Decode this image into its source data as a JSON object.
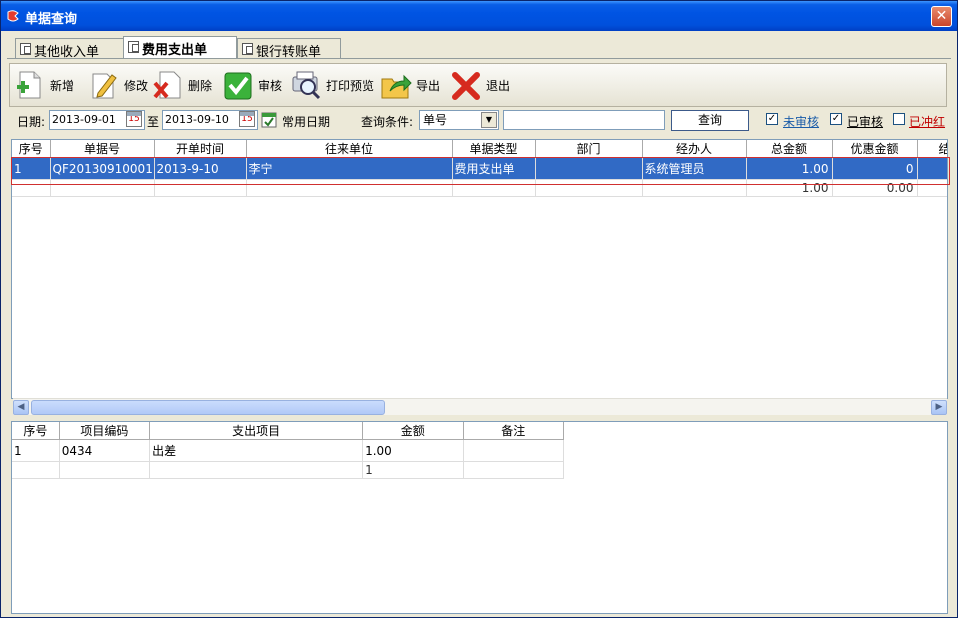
{
  "window": {
    "title": "单据查询",
    "close_glyph": "✕"
  },
  "tabs": [
    {
      "label": "其他收入单",
      "active": false
    },
    {
      "label": "费用支出单",
      "active": true
    },
    {
      "label": "银行转账单",
      "active": false
    }
  ],
  "toolbar": {
    "new": "新增",
    "edit": "修改",
    "delete": "删除",
    "audit": "审核",
    "print_preview": "打印预览",
    "export": "导出",
    "exit": "退出"
  },
  "filter": {
    "date_label": "日期:",
    "date_from": "2013-09-01",
    "to_label": "至",
    "date_to": "2013-09-10",
    "cal_glyph": "15",
    "common_date": "常用日期",
    "query_cond_label": "查询条件:",
    "query_cond_value": "单号",
    "query_text": "",
    "query_button": "查询",
    "unaudited": {
      "label": "未审核",
      "checked": true
    },
    "audited": {
      "label": "已审核",
      "checked": true
    },
    "reversed": {
      "label": "已冲红",
      "checked": false
    }
  },
  "main_grid": {
    "columns": [
      "序号",
      "单据号",
      "开单时间",
      "往来单位",
      "单据类型",
      "部门",
      "经办人",
      "总金额",
      "优惠金额",
      "结"
    ],
    "rows": [
      [
        "1",
        "QF20130910001",
        "2013-9-10",
        "李宁",
        "费用支出单",
        "",
        "系统管理员",
        "1.00",
        "0",
        ""
      ]
    ],
    "summary": [
      "",
      "",
      "",
      "",
      "",
      "",
      "",
      "1.00",
      "0.00",
      ""
    ]
  },
  "detail_grid": {
    "columns": [
      "序号",
      "项目编码",
      "支出项目",
      "金额",
      "备注"
    ],
    "rows": [
      [
        "1",
        "0434",
        "出差",
        "1.00",
        ""
      ]
    ],
    "summary": [
      "",
      "",
      "",
      "1",
      ""
    ]
  },
  "colors": {
    "title_bar": "#0054e3",
    "selection": "#316ac5",
    "highlight_outline": "#d03030"
  }
}
